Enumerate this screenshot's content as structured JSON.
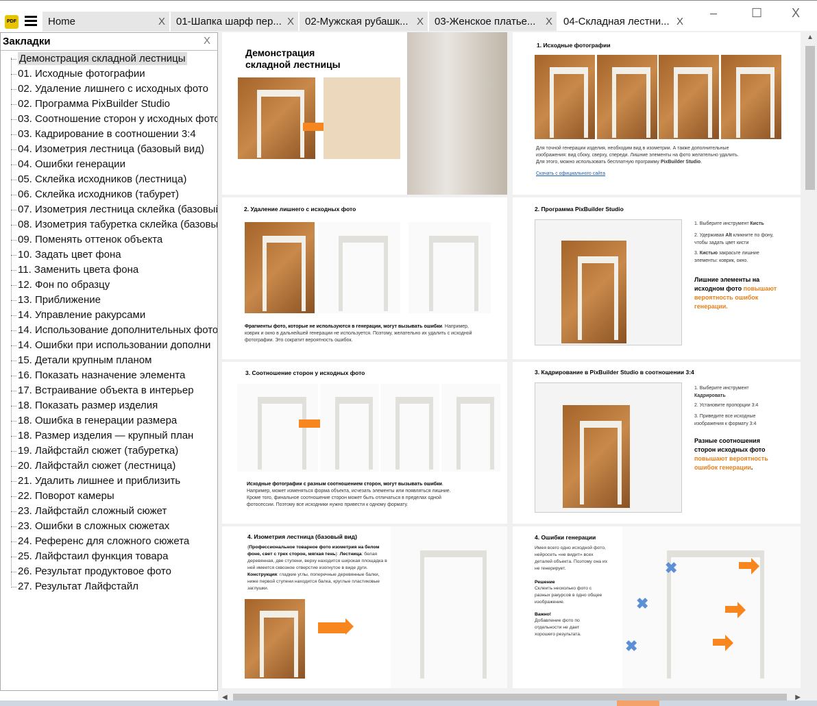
{
  "tabs": [
    {
      "label": "Home",
      "active": false
    },
    {
      "label": "01-Шапка шарф пер...",
      "active": false
    },
    {
      "label": "02-Мужская  рубашк...",
      "active": false
    },
    {
      "label": "03-Женское платье...",
      "active": false
    },
    {
      "label": "04-Складная лестни...",
      "active": true
    }
  ],
  "app": {
    "logo": "PDF",
    "close_glyph": "X",
    "minimize": "–",
    "maximize": "☐"
  },
  "sidebar": {
    "title": "Закладки",
    "items": [
      "Демонстрация складной лестницы",
      "01. Исходные фотографии",
      "02. Удаление лишнего с исходных фото",
      "02. Программа PixBuilder Studio",
      "03. Соотношение сторон у исходных фото",
      "03. Кадрирование в соотношении 3:4",
      "04. Изометрия лестница (базовый вид)",
      "04. Ошибки генерации",
      "05. Склейка исходников (лестница)",
      "06. Склейка исходников (табурет)",
      "07. Изометрия лестница склейка (базовый",
      "08. Изометрия табуретка склейка (базовый",
      "09. Поменять оттенок объекта",
      "10. Задать цвет фона",
      "11. Заменить цвета фона",
      "12. Фон по образцу",
      "13. Приближение",
      "14. Управление ракурсами",
      "14. Использование дополнительных фото",
      "14. Ошибки при использовании дополни",
      "15. Детали крупным планом",
      "16. Показать назначение элемента",
      "17. Встраивание объекта в интерьер",
      "18. Показать размер изделия",
      "18. Ошибка в генерации размера",
      "18. Размер изделия — крупный план",
      "19. Лайфстайл сюжет (табуретка)",
      "20. Лайфстайл сюжет (лестница)",
      "21. Удалить лишнее и приблизить",
      "22. Поворот камеры",
      "23. Лайфстайл сложный сюжет",
      "23. Ошибки в сложных сюжетах",
      "24. Референс для сложного сюжета",
      "25. Лайфстаил функция товара",
      "26. Результат продуктовое фото",
      "27. Результат Лайфстайл"
    ]
  },
  "pages": {
    "p0": {
      "title": "Демонстрация складной лестницы"
    },
    "p1": {
      "title": "1. Исходные фотографии",
      "text1": "Для точной генерации изделия, необходим вид в изометрии. А также дополнительные изображения: вид сбоку, сверху, спереди. Лишние элементы на фото желательно удалить. Для этого, можно использовать бесплатную программу ",
      "bold": "PixBuilder Studio",
      "link": "Скачать с официального сайта"
    },
    "p2": {
      "title": "2. Удаление лишнего с исходных фото",
      "bold": "Фрагменты фото, которые не используются в генерации, могут вызывать ошибки",
      "text": "Например, коврик и окно в дальнейшей генерации не используется. Поэтому, желательно их удалить с исходной фотографии. Это сократит вероятность ошибок."
    },
    "p3": {
      "title": "2. Программа PixBuilder Studio",
      "s1": "1. Выберите инструмент ",
      "s1b": "Кисть",
      "s2a": "2. Удерживая ",
      "s2b": "Alt",
      "s2c": " кликните по фону, чтобы задать цвет кисти",
      "s3a": "3. ",
      "s3b": "Кистью",
      "s3c": " закрасьте лишние элементы: коврик, окно.",
      "warn": "Лишние элементы на исходном фото ",
      "warn_orange": "повышают вероятность ошибок генерации."
    },
    "p4": {
      "title": "3. Соотношение сторон у исходных фото",
      "bold": "Исходные фотографии с разным соотношением сторон, могут вызывать ошибки",
      "text": "Например, может изменяться форма объекта, исчезать элементы или появляться лишние. Кроме того, финальное соотношение сторон может быть отличаться в пределах одной фотосессии. Поэтому все исходники нужно привести к одному формату."
    },
    "p5": {
      "title": "3. Кадрирование в PixBuilder Studio в соотношении 3:4",
      "s1": "1. Выберите инструмент ",
      "s1b": "Кадрировать",
      "s2": "2. Установите пропорции 3:4",
      "s3": "3. Приведите все исходные изображения к формату 3:4",
      "warn": "Разные соотношения сторон исходных фото ",
      "warn_orange": "повышают вероятность ошибок генерации"
    },
    "p6": {
      "title": "4. Изометрия лестница (базовый вид)",
      "prompt": "Профессиональное товарное фото изометрия на белом фоне, свет с трех сторон, мягкая тень",
      "l1": "Лестница",
      "t1": ": белая деревянная, две ступени, верху находится широкая площадка в ней имеется сквозное отверстие изогнутое в виде дуги. ",
      "l2": "Конструкция",
      "t2": ": гладкие углы, поперечные деревянные балки, ниже первой ступени находится балка, круглые пластиковые заглушки."
    },
    "p7": {
      "title": "4. Ошибки генерации",
      "t1": "Имея всего одно исходной фото, нейросеть «не видит» всех деталей объекта. Поэтому она их не генерирует.",
      "h2": "Решение",
      "t2": "Склеить несколько фото с разных ракурсов в одно общее изображение.",
      "h3": "Важно!",
      "t3": "Добавление фото по отдельности не дает хорошего результата."
    }
  },
  "colors": {
    "accent": "#f7861e",
    "link": "#1a5fb4"
  }
}
